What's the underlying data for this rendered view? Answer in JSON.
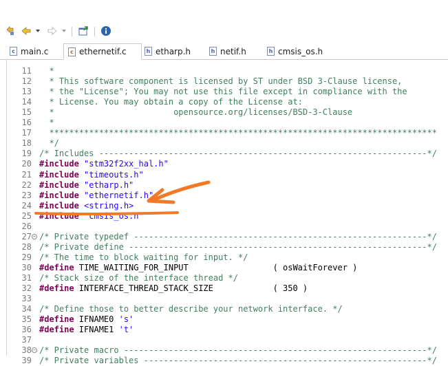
{
  "toolbar": {
    "icons": [
      "back-edit-icon",
      "back-arrow-icon",
      "dropdown-icon",
      "forward-arrow-icon",
      "dropdown-icon",
      "open-perspective-icon",
      "info-icon"
    ]
  },
  "tabs": [
    {
      "label": "main.c",
      "icon": "c-file-icon",
      "active": false
    },
    {
      "label": "ethernetif.c",
      "icon": "c-file-icon",
      "active": true
    },
    {
      "label": "etharp.h",
      "icon": "h-file-icon",
      "active": false
    },
    {
      "label": "netif.h",
      "icon": "h-file-icon",
      "active": false
    },
    {
      "label": "cmsis_os.h",
      "icon": "h-file-icon",
      "active": false
    }
  ],
  "code": [
    {
      "n": "11",
      "segments": [
        {
          "t": "  *",
          "c": "cm"
        }
      ]
    },
    {
      "n": "12",
      "segments": [
        {
          "t": "  * This software component is licensed by ST under BSD 3-Clause license,",
          "c": "cm"
        }
      ]
    },
    {
      "n": "13",
      "segments": [
        {
          "t": "  * the \"License\"; You may not use this file except in compliance with the",
          "c": "cm"
        }
      ]
    },
    {
      "n": "14",
      "segments": [
        {
          "t": "  * License. You may obtain a copy of the License at:",
          "c": "cm"
        }
      ]
    },
    {
      "n": "15",
      "segments": [
        {
          "t": "  *                        opensource.org/licenses/BSD-3-Clause",
          "c": "cm"
        }
      ]
    },
    {
      "n": "16",
      "segments": [
        {
          "t": "  *",
          "c": "cm"
        }
      ]
    },
    {
      "n": "17",
      "segments": [
        {
          "t": "  ******************************************************************************",
          "c": "cm"
        }
      ]
    },
    {
      "n": "18",
      "segments": [
        {
          "t": "  */",
          "c": "cm"
        }
      ]
    },
    {
      "n": "19",
      "segments": [
        {
          "t": "/* Includes ------------------------------------------------------------------*/",
          "c": "cm"
        }
      ]
    },
    {
      "n": "20",
      "segments": [
        {
          "t": "#include",
          "c": "kw"
        },
        {
          "t": " ",
          "c": "plain"
        },
        {
          "t": "\"stm32f2xx_hal.h\"",
          "c": "str"
        }
      ]
    },
    {
      "n": "21",
      "segments": [
        {
          "t": "#include",
          "c": "kw"
        },
        {
          "t": " ",
          "c": "plain"
        },
        {
          "t": "\"timeouts.h\"",
          "c": "str"
        }
      ]
    },
    {
      "n": "22",
      "segments": [
        {
          "t": "#include",
          "c": "kw"
        },
        {
          "t": " ",
          "c": "plain"
        },
        {
          "t": "\"etharp.h\"",
          "c": "str"
        }
      ]
    },
    {
      "n": "23",
      "segments": [
        {
          "t": "#include",
          "c": "kw"
        },
        {
          "t": " ",
          "c": "plain"
        },
        {
          "t": "\"ethernetif.h\"",
          "c": "str"
        }
      ]
    },
    {
      "n": "24",
      "segments": [
        {
          "t": "#include",
          "c": "kw"
        },
        {
          "t": " ",
          "c": "plain"
        },
        {
          "t": "<string.h>",
          "c": "str"
        }
      ]
    },
    {
      "n": "25",
      "segments": [
        {
          "t": "#include",
          "c": "kw"
        },
        {
          "t": " ",
          "c": "plain"
        },
        {
          "t": "\"cmsis_os.h\"",
          "c": "str"
        }
      ]
    },
    {
      "n": "26",
      "segments": []
    },
    {
      "n": "27",
      "fold": true,
      "segments": [
        {
          "t": "/* Private typedef -----------------------------------------------------------*/",
          "c": "cm"
        }
      ]
    },
    {
      "n": "28",
      "segments": [
        {
          "t": "/* Private define ------------------------------------------------------------*/",
          "c": "cm"
        }
      ]
    },
    {
      "n": "29",
      "segments": [
        {
          "t": "/* The time to block waiting for input. */",
          "c": "cm"
        }
      ]
    },
    {
      "n": "30",
      "segments": [
        {
          "t": "#define",
          "c": "kw"
        },
        {
          "t": " TIME_WAITING_FOR_INPUT                 ( osWaitForever )",
          "c": "plain"
        }
      ]
    },
    {
      "n": "31",
      "segments": [
        {
          "t": "/* Stack size of the interface thread */",
          "c": "cm"
        }
      ]
    },
    {
      "n": "32",
      "segments": [
        {
          "t": "#define",
          "c": "kw"
        },
        {
          "t": " INTERFACE_THREAD_STACK_SIZE            ( 350 )",
          "c": "plain"
        }
      ]
    },
    {
      "n": "33",
      "segments": []
    },
    {
      "n": "34",
      "segments": [
        {
          "t": "/* Define those to better describe your network interface. */",
          "c": "cm"
        }
      ]
    },
    {
      "n": "35",
      "segments": [
        {
          "t": "#define",
          "c": "kw"
        },
        {
          "t": " IFNAME0 ",
          "c": "plain"
        },
        {
          "t": "'s'",
          "c": "str"
        }
      ]
    },
    {
      "n": "36",
      "segments": [
        {
          "t": "#define",
          "c": "kw"
        },
        {
          "t": " IFNAME1 ",
          "c": "plain"
        },
        {
          "t": "'t'",
          "c": "str"
        }
      ]
    },
    {
      "n": "37",
      "segments": []
    },
    {
      "n": "38",
      "fold": true,
      "segments": [
        {
          "t": "/* Private macro -------------------------------------------------------------*/",
          "c": "cm"
        }
      ]
    },
    {
      "n": "39",
      "segments": [
        {
          "t": "/* Private variables ---------------------------------------------------------*/",
          "c": "cm"
        }
      ]
    }
  ],
  "colors": {
    "comment": "#3f7f5f",
    "keyword": "#7f0055",
    "string": "#2a00ff",
    "line_number": "#7a7a7a",
    "annotation": "#f07a28"
  }
}
